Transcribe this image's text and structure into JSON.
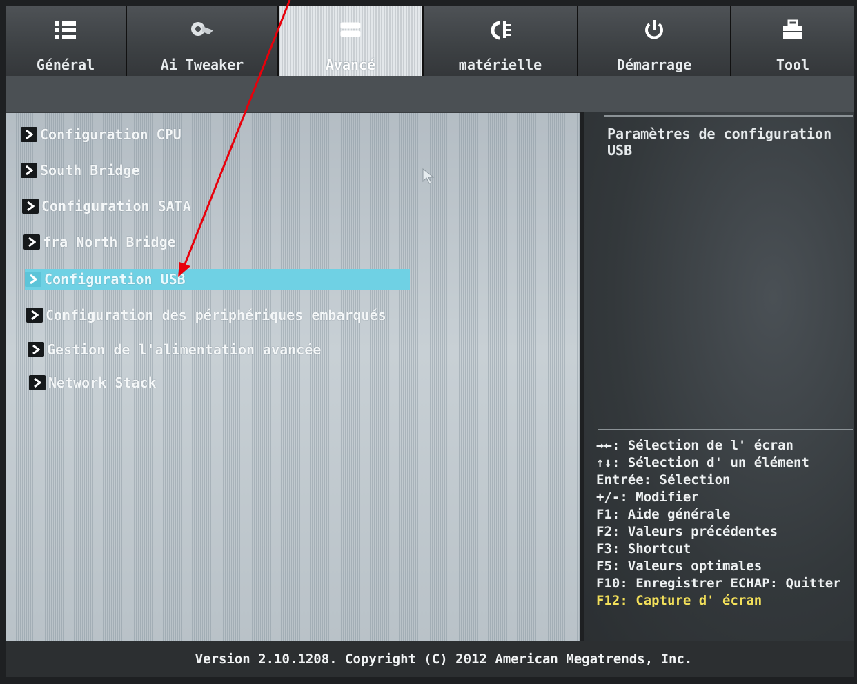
{
  "tabs": [
    {
      "label": "Général",
      "icon": "list-icon"
    },
    {
      "label": "Ai Tweaker",
      "icon": "tweaker-icon"
    },
    {
      "label": "Avancé",
      "icon": "advanced-icon",
      "active": true
    },
    {
      "label": "matérielle",
      "icon": "monitor-icon"
    },
    {
      "label": "Démarrage",
      "icon": "power-icon"
    },
    {
      "label": "Tool",
      "icon": "toolbox-icon"
    }
  ],
  "menu": {
    "items": [
      {
        "label": "Configuration CPU"
      },
      {
        "label": "South Bridge"
      },
      {
        "label": "Configuration SATA"
      },
      {
        "label": "fra North Bridge"
      },
      {
        "label": "Configuration USB",
        "selected": true
      },
      {
        "label": "Configuration des périphériques embarqués"
      },
      {
        "label": "Gestion de l'alimentation avancée"
      },
      {
        "label": "Network Stack"
      }
    ]
  },
  "side": {
    "description": "Paramètres de configuration USB",
    "help": [
      "→←: Sélection de l' écran",
      "↑↓: Sélection d' un élément",
      "Entrée: Sélection",
      "+/-: Modifier",
      "F1: Aide générale",
      "F2: Valeurs précédentes",
      "F3: Shortcut",
      "F5: Valeurs optimales",
      "F10: Enregistrer  ECHAP: Quitter",
      "F12: Capture d' écran"
    ]
  },
  "footer": {
    "version": "Version 2.10.1208. Copyright (C) 2012 American Megatrends, Inc."
  },
  "colors": {
    "selection": "#6fd1e4",
    "annotation_arrow": "#e8000b",
    "highlight_help": "#f3e05a"
  }
}
